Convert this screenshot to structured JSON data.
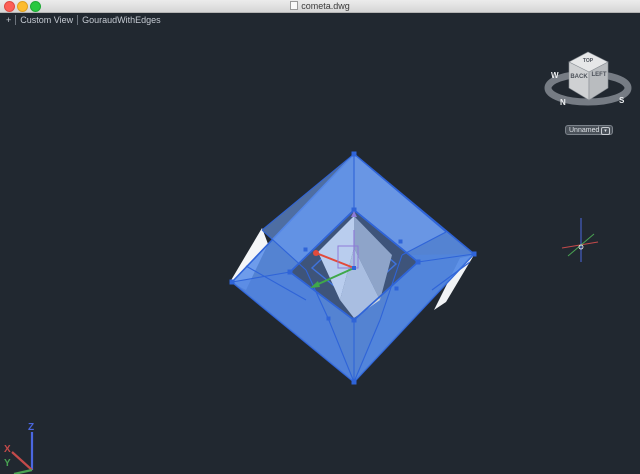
{
  "window": {
    "title": "cometa.dwg"
  },
  "viewport": {
    "plus_label": "+",
    "view_label": "Custom View",
    "style_label": "GouraudWithEdges"
  },
  "viewcube": {
    "face_top": "TOP",
    "face_front": "BACK",
    "face_right": "LEFT",
    "compass_w": "W",
    "compass_s": "S",
    "compass_n": "N",
    "menu_label": "Unnamed"
  },
  "ucs_icon": {
    "x_label": "X",
    "y_label": "Y",
    "z_label": "Z"
  },
  "colors": {
    "background": "#212830",
    "model_blue": "#5b8fe8",
    "edge_blue": "#2f64d8"
  },
  "icons": {
    "app_document": "dwg-file-icon",
    "cube": "viewcube-icon",
    "gizmo": "move-gizmo-icon",
    "pivot": "3d-orbit-pivot-icon",
    "ucs": "ucs-icon"
  }
}
